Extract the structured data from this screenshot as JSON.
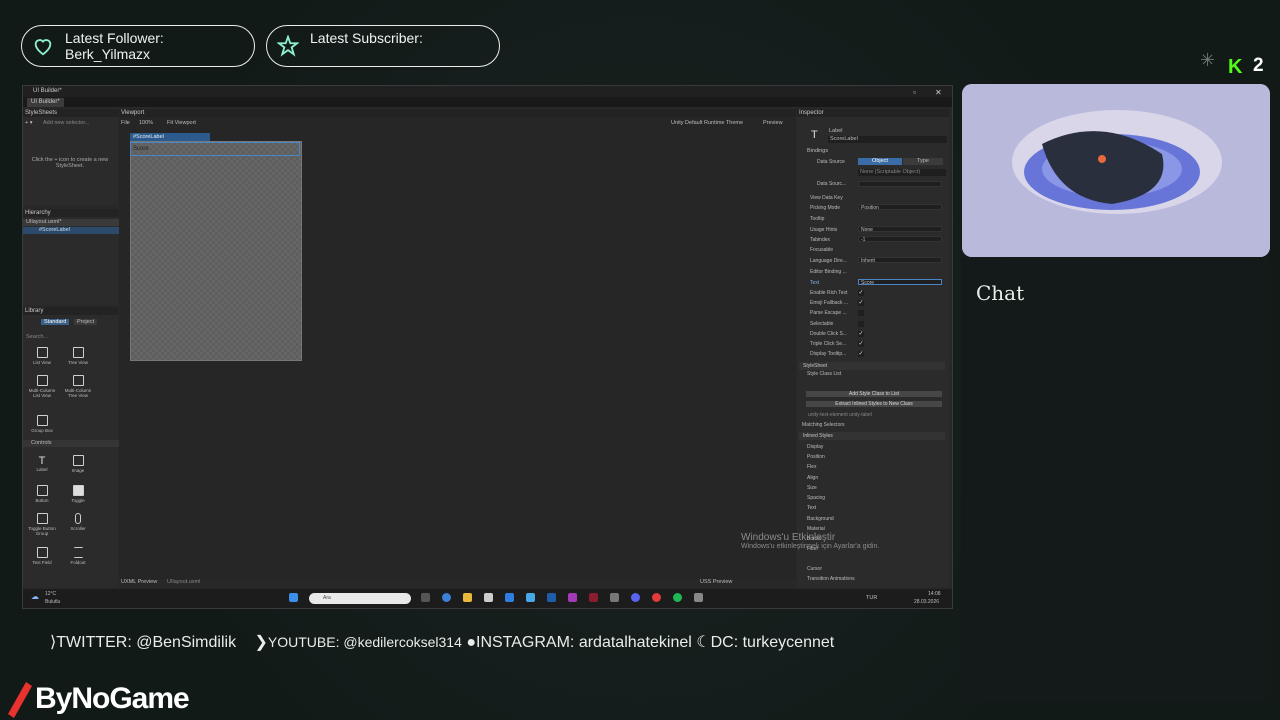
{
  "overlay": {
    "latest_follower": "Latest Follower:\nBerk_Yilmazx",
    "latest_subscriber": "Latest Subscriber:",
    "kick_count": "2",
    "chat_title": "Chat",
    "socials": {
      "twitter": "TWITTER: @BenSimdilik",
      "youtube": "YOUTUBE: @kedilercoksel314",
      "instagram": "INSTAGRAM: ardatalhatekinel",
      "discord": "DC: turkeycennet"
    },
    "brand": "ByNoGame",
    "accent": "#53fc18"
  },
  "unity": {
    "window_title": "UI Builder*",
    "tab": "UI Builder*",
    "stylesheets": {
      "title": "StyleSheets",
      "add_selector": "Add new selector...",
      "hint": "Click the + icon to create a new StyleSheet."
    },
    "hierarchy": {
      "title": "Hierarchy",
      "root": "UIlayout.uxml*",
      "child": "#ScoreLabel"
    },
    "viewport": {
      "title": "Viewport",
      "file": "File",
      "zoom": "100%",
      "fit": "Fit Viewport",
      "theme": "Unity Default Runtime Theme",
      "preview": "Preview",
      "selected_label": "#ScoreLabel",
      "score_text": "Score",
      "uxml_preview": "UXML Preview",
      "uxml_file": "UIlayout.uxml",
      "uss_preview": "USS Preview"
    },
    "library": {
      "title": "Library",
      "tab_standard": "Standard",
      "tab_project": "Project",
      "search": "Search...",
      "items": [
        "List View",
        "Tree View",
        "Multi-Column List View",
        "Multi-Column Tree View",
        "Group Box"
      ],
      "controls_section": "Controls",
      "controls": [
        "Label",
        "Image",
        "Button",
        "Toggle",
        "Toggle Button Group",
        "Scroller",
        "Text Field",
        "Foldout"
      ]
    },
    "inspector": {
      "title": "Inspector",
      "element_type": "Label",
      "element_name": "ScoreLabel",
      "bindings": "Bindings",
      "data_source": "Data Source",
      "object": "Object",
      "type": "Type",
      "none_scriptable": "None (Scriptable Object)",
      "data_source_path": "Data Sourc...",
      "rows": [
        {
          "label": "View Data Key",
          "value": ""
        },
        {
          "label": "Picking Mode",
          "value": "Position"
        },
        {
          "label": "Tooltip",
          "value": ""
        },
        {
          "label": "Usage Hints",
          "value": "None"
        },
        {
          "label": "Tabindex",
          "value": "-1"
        },
        {
          "label": "Focusable",
          "value": ""
        },
        {
          "label": "Language Dire...",
          "value": "Inherit"
        },
        {
          "label": "Editor Binding ...",
          "value": ""
        },
        {
          "label": "Text",
          "value": "Score"
        }
      ],
      "checks": [
        {
          "label": "Enable Rich Text",
          "checked": "✓"
        },
        {
          "label": "Emoji Fallback ...",
          "checked": "✓"
        },
        {
          "label": "Parse Escape ...",
          "checked": ""
        },
        {
          "label": "Selectable",
          "checked": ""
        },
        {
          "label": "Double Click S...",
          "checked": "✓"
        },
        {
          "label": "Triple Click Se...",
          "checked": "✓"
        },
        {
          "label": "Display Tooltip...",
          "checked": "✓"
        }
      ],
      "stylesheet": "StyleSheet",
      "style_class_list": "Style Class List",
      "add_style_class": "Add Style Class to List",
      "extract_inlined": "Extract Inlined Styles to New Class",
      "classes": "unity-text-element   unity-label",
      "matching_selectors": "Matching Selectors",
      "inlined_styles": "Inlined Styles",
      "style_sections": [
        "Display",
        "Position",
        "Flex",
        "Align",
        "Size",
        "Spacing",
        "Text",
        "Background",
        "Material",
        "Border",
        "Filter",
        "Cursor",
        "Transition Animations"
      ]
    },
    "activate": {
      "line1": "Windows'u Etkinleştir",
      "line2": "Windows'u etkinleştirmek için Ayarlar'a gidin."
    },
    "taskbar": {
      "weather_temp": "12°C",
      "weather_desc": "Bulutlu",
      "search": "Ara",
      "lang": "TUR",
      "time": "14:08",
      "date": "28.03.2026"
    }
  }
}
